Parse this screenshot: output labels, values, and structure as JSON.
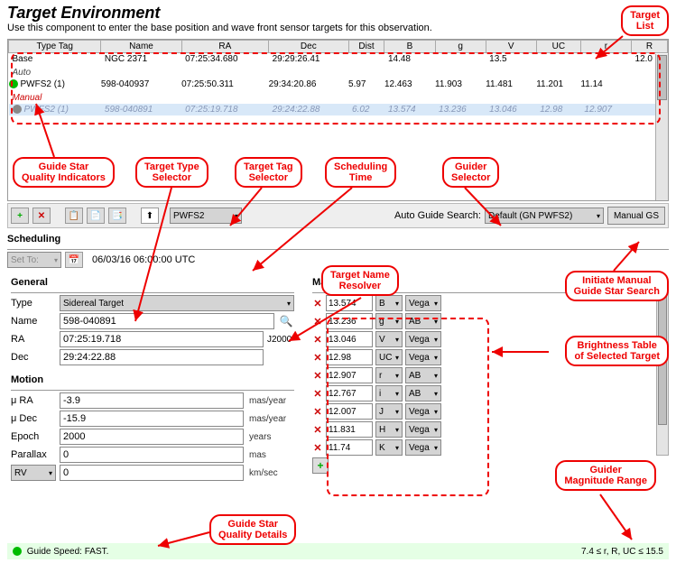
{
  "title": "Target Environment",
  "subtitle": "Use this component to enter the base position and wave front sensor targets for this observation.",
  "columns": [
    "Type Tag",
    "Name",
    "RA",
    "Dec",
    "Dist",
    "B",
    "g",
    "V",
    "UC",
    "r",
    "R"
  ],
  "rows": {
    "base": {
      "tag": "Base",
      "name": "NGC 2371",
      "ra": "07:25:34.680",
      "dec": "29:29:26.41",
      "dist": "",
      "b": "14.48",
      "g": "",
      "v": "13.5",
      "uc": "",
      "r": "",
      "R": "12.0"
    },
    "auto": {
      "label": "Auto"
    },
    "pwfs": {
      "tag": "PWFS2 (1)",
      "name": "598-040937",
      "ra": "07:25:50.311",
      "dec": "29:34:20.86",
      "dist": "5.97",
      "b": "12.463",
      "g": "11.903",
      "v": "11.481",
      "uc": "11.201",
      "r": "11.14",
      "R": ""
    },
    "man": {
      "label": "Manual"
    },
    "pwfs2": {
      "tag": "PWFS2 (1)",
      "name": "598-040891",
      "ra": "07:25:19.718",
      "dec": "29:24:22.88",
      "dist": "6.02",
      "b": "13.574",
      "g": "13.236",
      "v": "13.046",
      "uc": "12.98",
      "r": "12.907",
      "R": ""
    }
  },
  "toolbar": {
    "tag_selector": "PWFS2",
    "ags_label": "Auto Guide Search:",
    "ags_value": "Default (GN PWFS2)",
    "manual_gs": "Manual GS"
  },
  "scheduling": {
    "legend": "Scheduling",
    "set_to": "Set To:",
    "time": "06/03/16 06:00:00 UTC"
  },
  "general": {
    "legend": "General",
    "type_label": "Type",
    "type_value": "Sidereal Target",
    "name_label": "Name",
    "name_value": "598-040891",
    "ra_label": "RA",
    "ra_value": "07:25:19.718",
    "dec_label": "Dec",
    "dec_value": "29:24:22.88",
    "epoch": "J2000"
  },
  "motion": {
    "legend": "Motion",
    "mu_ra_label": "μ RA",
    "mu_ra_value": "-3.9",
    "mu_ra_unit": "mas/year",
    "mu_dec_label": "μ Dec",
    "mu_dec_value": "-15.9",
    "mu_dec_unit": "mas/year",
    "epoch_label": "Epoch",
    "epoch_value": "2000",
    "epoch_unit": "years",
    "parallax_label": "Parallax",
    "parallax_value": "0",
    "parallax_unit": "mas",
    "rv_label": "RV",
    "rv_value": "0",
    "rv_unit": "km/sec"
  },
  "magnitudes": {
    "legend": "Magnitudes",
    "rows": [
      {
        "v": "13.574",
        "b": "B",
        "s": "Vega"
      },
      {
        "v": "13.236",
        "b": "g",
        "s": "AB"
      },
      {
        "v": "13.046",
        "b": "V",
        "s": "Vega"
      },
      {
        "v": "12.98",
        "b": "UC",
        "s": "Vega"
      },
      {
        "v": "12.907",
        "b": "r",
        "s": "AB"
      },
      {
        "v": "12.767",
        "b": "i",
        "s": "AB"
      },
      {
        "v": "12.007",
        "b": "J",
        "s": "Vega"
      },
      {
        "v": "11.831",
        "b": "H",
        "s": "Vega"
      },
      {
        "v": "11.74",
        "b": "K",
        "s": "Vega"
      }
    ]
  },
  "status": {
    "speed": "Guide Speed: FAST.",
    "range": "7.4 ≤ r, R, UC ≤ 15.5"
  },
  "callouts": {
    "target_list": "Target\nList",
    "gsqi": "Guide Star\nQuality Indicators",
    "tts": "Target Type\nSelector",
    "ttag": "Target Tag\nSelector",
    "sched": "Scheduling\nTime",
    "gs": "Guider\nSelector",
    "resolver": "Target Name\nResolver",
    "imgs": "Initiate Manual\nGuide Star Search",
    "bt": "Brightness Table\nof Selected Target",
    "gmr": "Guider\nMagnitude Range",
    "gsqd": "Guide Star\nQuality Details"
  }
}
